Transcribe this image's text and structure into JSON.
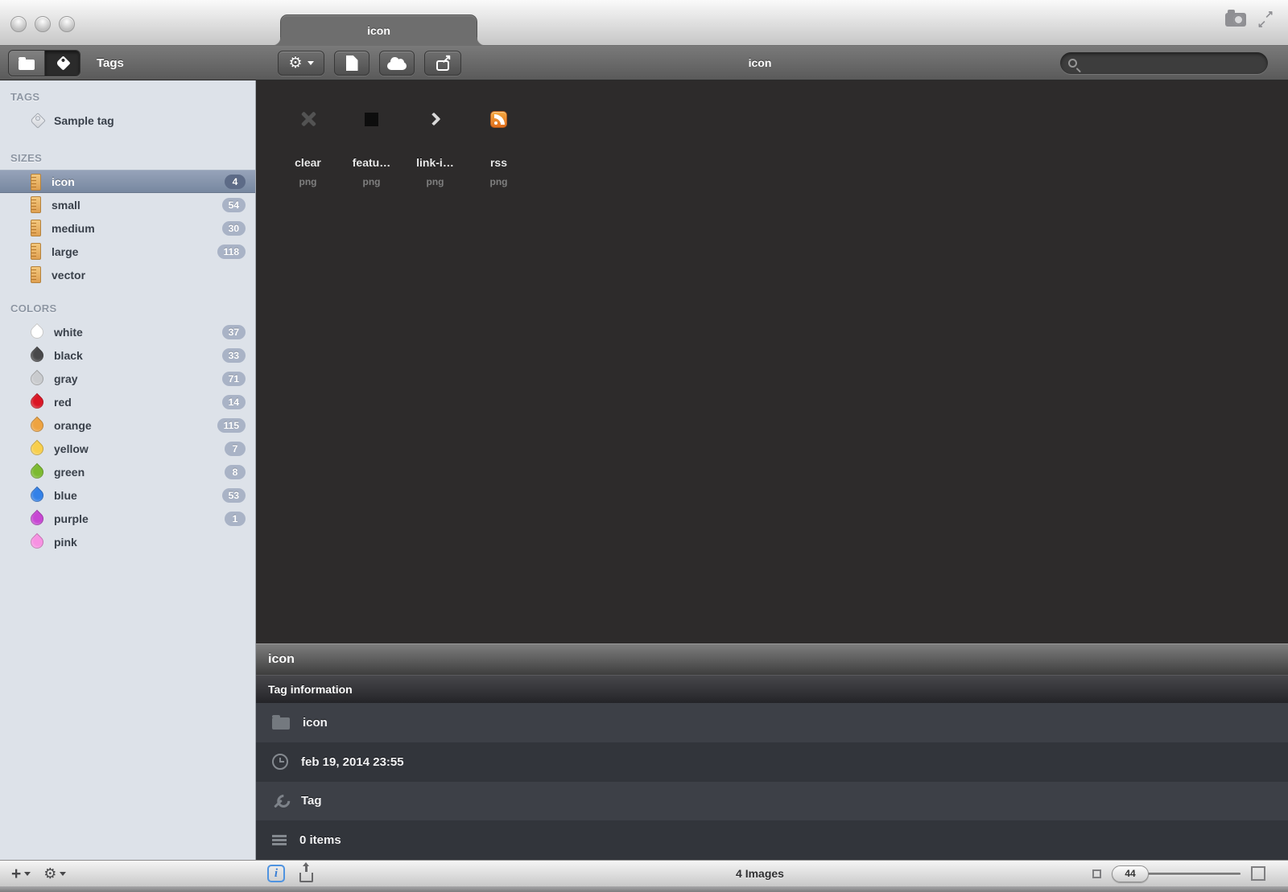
{
  "window": {
    "tab_title": "icon"
  },
  "toolbar": {
    "mode_label": "Tags",
    "center_title": "icon",
    "search_value": ""
  },
  "sidebar": {
    "tags_header": "TAGS",
    "sizes_header": "SIZES",
    "colors_header": "COLORS",
    "tag_items": [
      {
        "label": "Sample tag"
      }
    ],
    "size_items": [
      {
        "label": "icon",
        "count": "4",
        "selected": true
      },
      {
        "label": "small",
        "count": "54"
      },
      {
        "label": "medium",
        "count": "30"
      },
      {
        "label": "large",
        "count": "118"
      },
      {
        "label": "vector",
        "count": ""
      }
    ],
    "color_items": [
      {
        "label": "white",
        "count": "37",
        "swatch": "#ffffff"
      },
      {
        "label": "black",
        "count": "33",
        "swatch": "#48484a"
      },
      {
        "label": "gray",
        "count": "71",
        "swatch": "#c9cbce"
      },
      {
        "label": "red",
        "count": "14",
        "swatch": "#da1625"
      },
      {
        "label": "orange",
        "count": "115",
        "swatch": "#eea341"
      },
      {
        "label": "yellow",
        "count": "7",
        "swatch": "#f8cf4c"
      },
      {
        "label": "green",
        "count": "8",
        "swatch": "#7cba30"
      },
      {
        "label": "blue",
        "count": "53",
        "swatch": "#3381e8"
      },
      {
        "label": "purple",
        "count": "1",
        "swatch": "#c746d3"
      },
      {
        "label": "pink",
        "count": "",
        "swatch": "#f791e2"
      }
    ]
  },
  "content": {
    "thumbnails": [
      {
        "name": "clear",
        "ext": "png",
        "icon": "x-icon"
      },
      {
        "name": "featu…",
        "ext": "png",
        "icon": "black-square-icon"
      },
      {
        "name": "link-i…",
        "ext": "png",
        "icon": "chevron-right-icon"
      },
      {
        "name": "rss",
        "ext": "png",
        "icon": "rss-icon"
      }
    ]
  },
  "info_panel": {
    "header_title": "icon",
    "section_title": "Tag information",
    "rows": [
      {
        "icon": "folder-icon",
        "value": "icon"
      },
      {
        "icon": "clock-icon",
        "value": "feb 19, 2014 23:55"
      },
      {
        "icon": "wrench-icon",
        "value": "Tag"
      },
      {
        "icon": "list-icon",
        "value": "0 items"
      }
    ]
  },
  "statusbar": {
    "images_count": "4 Images",
    "zoom_value": "44"
  },
  "theme": {
    "selected_row": "#76879f",
    "badge_bg": "#a9b3c6",
    "content_bg": "#2d2b2b",
    "rss_orange": "#e8822c",
    "info_button_blue": "#4f93e0"
  }
}
